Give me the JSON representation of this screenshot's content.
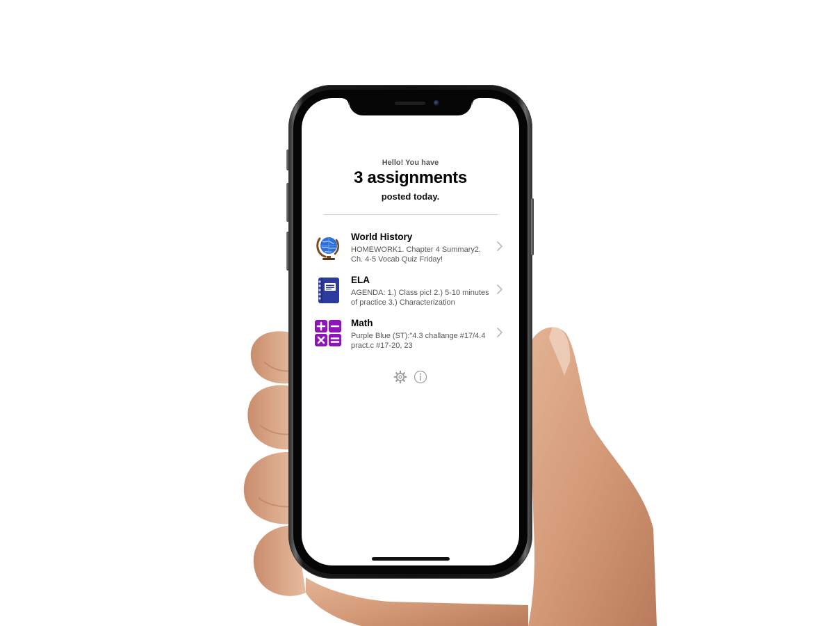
{
  "header": {
    "greeting": "Hello! You have",
    "headline": "3 assignments",
    "subline": "posted today."
  },
  "assignments": [
    {
      "title": "World History",
      "description": "HOMEWORK1. Chapter 4 Summary2. Ch. 4-5 Vocab Quiz Friday!",
      "icon": "globe-icon"
    },
    {
      "title": "ELA",
      "description": "AGENDA: 1.) Class pic! 2.) 5-10 minutes of practice 3.) Characterization",
      "icon": "notebook-icon"
    },
    {
      "title": "Math",
      "description": "Purple  Blue (ST):\"4.3 challange #17/4.4 pract.c #17-20, 23",
      "icon": "math-symbols-icon"
    }
  ],
  "footer": {
    "settings_icon": "gear-icon",
    "info_icon": "info-icon"
  },
  "colors": {
    "math_purple": "#8e16b8",
    "ela_blue": "#2d3a9e",
    "globe_blue": "#2f6fd8",
    "chevron_gray": "#b8b8bd"
  }
}
